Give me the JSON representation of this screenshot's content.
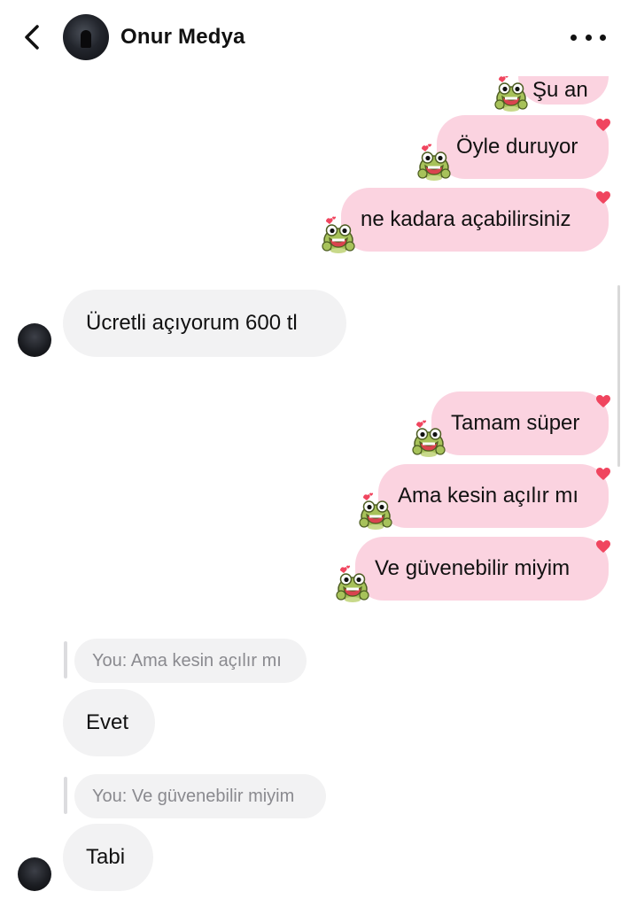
{
  "header": {
    "contact_name": "Onur Medya",
    "back_icon": "chevron-left-icon",
    "more_icon": "more-horizontal-icon"
  },
  "messages": [
    {
      "direction": "outgoing",
      "text": "Şu an",
      "partially_visible": true
    },
    {
      "direction": "outgoing",
      "text": "Öyle duruyor"
    },
    {
      "direction": "outgoing",
      "text": "ne kadara açabilirsiniz"
    },
    {
      "direction": "incoming",
      "text": "Ücretli açıyorum 600 tl"
    },
    {
      "direction": "outgoing",
      "text": "Tamam süper"
    },
    {
      "direction": "outgoing",
      "text": "Ama kesin açılır mı"
    },
    {
      "direction": "outgoing",
      "text": "Ve güvenebilir miyim"
    },
    {
      "direction": "incoming",
      "reply_to": "You: Ama kesin açılır mı",
      "text": "Evet"
    },
    {
      "direction": "incoming",
      "reply_to": "You: Ve güvenebilir miyim",
      "text": "Tabi"
    }
  ],
  "colors": {
    "outgoing_bubble": "#fbd3e0",
    "incoming_bubble": "#f2f2f3",
    "heart": "#f0455f",
    "reply_text": "#8a8a8f"
  },
  "icons": {
    "reaction": "heart-icon",
    "sticker": "frog-sticker-icon"
  }
}
